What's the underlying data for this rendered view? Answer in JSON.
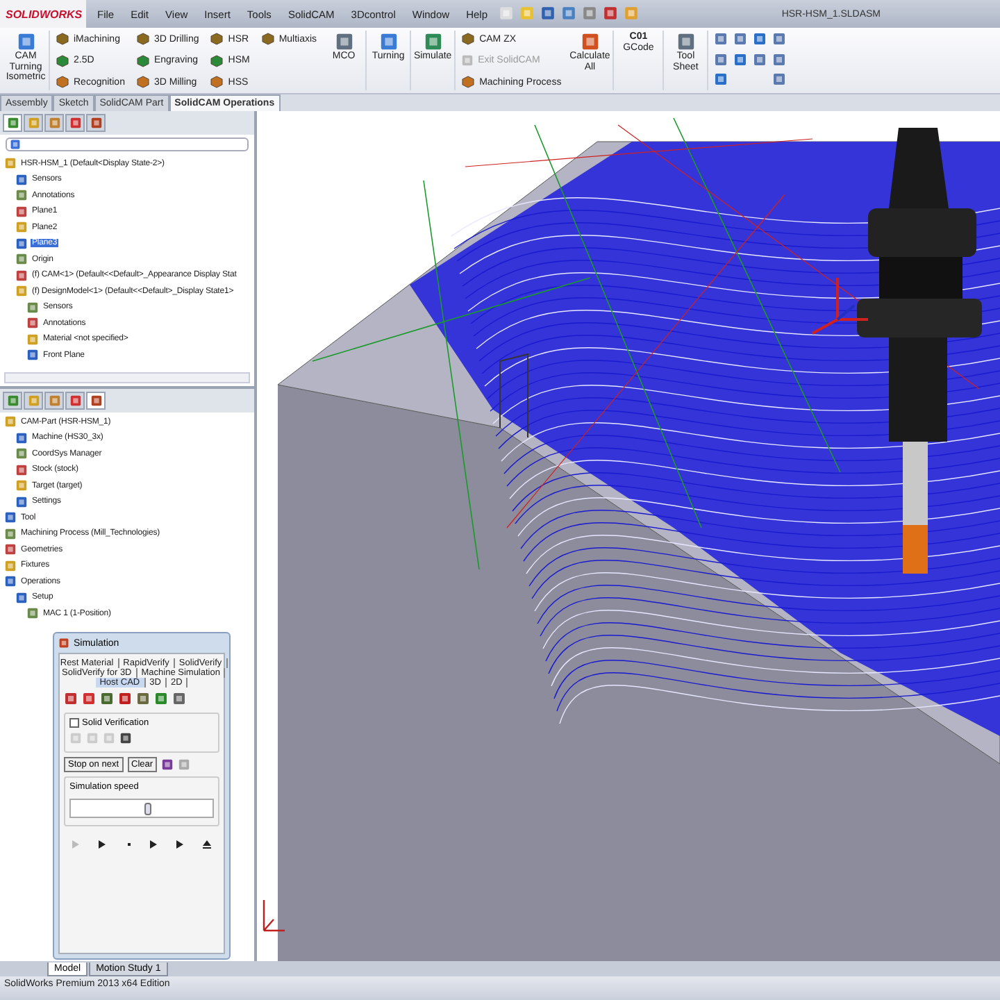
{
  "app": {
    "logo": "SOLIDWORKS",
    "menu": [
      "File",
      "Edit",
      "View",
      "Insert",
      "Tools",
      "SolidCAM",
      "3Dcontrol",
      "Window",
      "Help"
    ],
    "document_title": "HSR-HSM_1.SLDASM"
  },
  "ribbon": [
    {
      "kind": "large",
      "label": "CAM Turning Isometric"
    },
    {
      "kind": "column",
      "items": [
        {
          "label": "iMachining",
          "disabled": false
        },
        {
          "label": "2.5D",
          "disabled": false
        },
        {
          "label": "Recognition",
          "disabled": false
        }
      ]
    },
    {
      "kind": "column",
      "items": [
        {
          "label": "3D Drilling",
          "disabled": false
        },
        {
          "label": "Engraving",
          "disabled": false
        },
        {
          "label": "3D Milling",
          "disabled": false
        }
      ]
    },
    {
      "kind": "column",
      "items": [
        {
          "label": "HSR",
          "disabled": false
        },
        {
          "label": "HSM",
          "disabled": false
        },
        {
          "label": "HSS",
          "disabled": false
        }
      ]
    },
    {
      "kind": "column",
      "items": [
        {
          "label": "Multiaxis",
          "disabled": false
        }
      ]
    },
    {
      "kind": "large",
      "label": "MCO"
    },
    {
      "kind": "large",
      "label": "Turning"
    },
    {
      "kind": "large",
      "label": "Simulate"
    },
    {
      "kind": "column",
      "items": [
        {
          "label": "CAM ZX",
          "disabled": false
        },
        {
          "label": "Exit SolidCAM",
          "disabled": true
        },
        {
          "label": "Machining Process",
          "disabled": false
        }
      ]
    },
    {
      "kind": "large",
      "label": "Calculate All"
    },
    {
      "kind": "code",
      "badge": "C01",
      "label": "GCode"
    },
    {
      "kind": "large",
      "label": "Tool Sheet"
    }
  ],
  "tabs": [
    {
      "label": "Assembly",
      "selected": false
    },
    {
      "label": "Sketch",
      "selected": false
    },
    {
      "label": "SolidCAM Part",
      "selected": false
    },
    {
      "label": "SolidCAM Operations",
      "selected": true
    }
  ],
  "feature_manager": {
    "panel_tabs": [
      {
        "selected": true
      },
      {
        "selected": false
      },
      {
        "selected": false
      },
      {
        "selected": false
      },
      {
        "selected": false
      }
    ],
    "tree": [
      {
        "label": "HSR-HSM_1  (Default<Display State-2>)",
        "selected": false,
        "children": [
          {
            "label": "Sensors",
            "selected": false
          },
          {
            "label": "Annotations",
            "selected": false
          },
          {
            "label": "Plane1",
            "selected": false
          },
          {
            "label": "Plane2",
            "selected": false
          },
          {
            "label": "Plane3",
            "selected": true
          },
          {
            "label": "Origin",
            "selected": false
          },
          {
            "label": "(f) CAM<1> (Default<<Default>_Appearance Display Stat",
            "selected": false
          },
          {
            "label": "(f) DesignModel<1> (Default<<Default>_Display State1>",
            "selected": false,
            "children": [
              {
                "label": "Sensors",
                "selected": false
              },
              {
                "label": "Annotations",
                "selected": false
              },
              {
                "label": "Material <not specified>",
                "selected": false
              },
              {
                "label": "Front Plane",
                "selected": false
              }
            ]
          }
        ]
      }
    ]
  },
  "cam_manager": {
    "panel_tabs": [
      {
        "selected": false
      },
      {
        "selected": false
      },
      {
        "selected": false
      },
      {
        "selected": false
      },
      {
        "selected": true
      }
    ],
    "tree": [
      {
        "label": "CAM-Part (HSR-HSM_1)",
        "children": [
          {
            "label": "Machine (HS30_3x)"
          },
          {
            "label": "CoordSys Manager"
          },
          {
            "label": "Stock (stock)"
          },
          {
            "label": "Target (target)"
          },
          {
            "label": "Settings"
          }
        ]
      },
      {
        "label": "Tool"
      },
      {
        "label": "Machining Process (Mill_Technologies)"
      },
      {
        "label": "Geometries"
      },
      {
        "label": "Fixtures"
      },
      {
        "label": "Operations",
        "children": [
          {
            "label": "Setup",
            "children": [
              {
                "label": "MAC 1 (1-Position)"
              }
            ]
          }
        ]
      }
    ]
  },
  "simulation": {
    "title": "Simulation",
    "tab_rows": [
      [
        {
          "label": "Rest Material",
          "selected": false
        },
        {
          "label": "RapidVerify",
          "selected": false
        },
        {
          "label": "SolidVerify",
          "selected": false
        }
      ],
      [
        {
          "label": "SolidVerify for 3D",
          "selected": false
        },
        {
          "label": "Machine Simulation",
          "selected": false
        }
      ],
      [
        {
          "label": "Host CAD",
          "selected": true
        },
        {
          "label": "3D",
          "selected": false
        },
        {
          "label": "2D",
          "selected": false
        }
      ]
    ],
    "solid_verification": {
      "label": "Solid Verification",
      "checked": false
    },
    "buttons": [
      "Stop on next",
      "Clear"
    ],
    "speed": {
      "label": "Simulation speed",
      "level": 0.55
    }
  },
  "bottom_tabs": [
    {
      "label": "Model",
      "selected": true
    },
    {
      "label": "Motion Study 1",
      "selected": false
    }
  ],
  "status_bar": "SolidWorks Premium 2013 x64 Edition"
}
